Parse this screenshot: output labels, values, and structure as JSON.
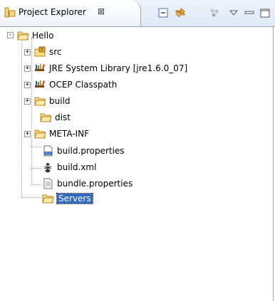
{
  "view": {
    "title": "Project Explorer",
    "close_glyph": "⊠"
  },
  "toolbar": [
    {
      "name": "collapse-all-icon"
    },
    {
      "name": "link-with-editor-icon"
    },
    {
      "name": "working-sets-icon"
    },
    {
      "name": "view-menu-icon"
    },
    {
      "name": "minimize-icon"
    },
    {
      "name": "maximize-icon"
    }
  ],
  "tree": {
    "root": {
      "label": "Hello",
      "expander": "-",
      "icon": "project-folder-icon"
    },
    "children": [
      {
        "label": "src",
        "expander": "+",
        "icon": "source-folder-icon"
      },
      {
        "label": "JRE System Library [jre1.6.0_07]",
        "expander": "+",
        "icon": "library-icon"
      },
      {
        "label": "OCEP Classpath",
        "expander": "+",
        "icon": "library-icon"
      },
      {
        "label": "build",
        "expander": "+",
        "icon": "folder-icon"
      },
      {
        "label": "dist",
        "expander": "",
        "icon": "folder-icon"
      },
      {
        "label": "META-INF",
        "expander": "+",
        "icon": "folder-icon"
      },
      {
        "label": "build.properties",
        "expander": "",
        "icon": "properties-file-icon"
      },
      {
        "label": "build.xml",
        "expander": "",
        "icon": "ant-file-icon"
      },
      {
        "label": "bundle.properties",
        "expander": "",
        "icon": "text-file-icon"
      }
    ],
    "second_root": {
      "label": "Servers",
      "icon": "folder-icon",
      "selected": true
    }
  }
}
